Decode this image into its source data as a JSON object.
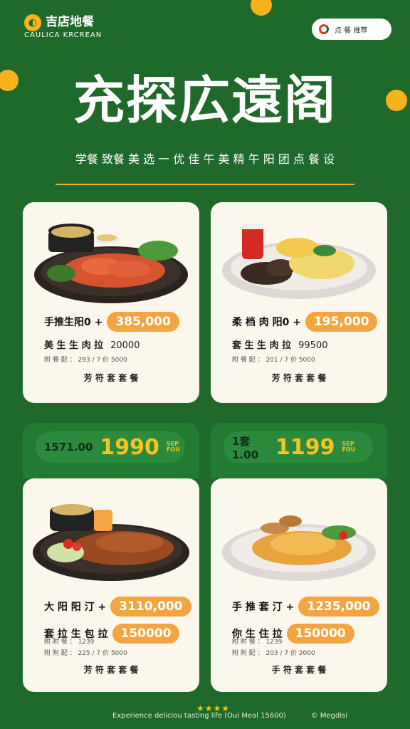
{
  "brand": {
    "logo_icon": "leaf-circle-icon",
    "name": "吉店地餐",
    "subtitle": "CAULICA KRCREAN"
  },
  "header_pill": {
    "icon": "c-logo-icon",
    "text": "点 餐 推荐"
  },
  "headline": "充探広遠阁",
  "subline": "学餐 致餐 美 选 一 优 佳 午 美 精 午 阳 团 点 餐 设",
  "cards": [
    {
      "name": "手推生阳0 +",
      "price": "385,000",
      "detail_label": "美 生 生 肉 拉",
      "detail_value": "20000",
      "tiny": "附 餐 配 ： 293 / 7 价 5000",
      "action": "芳 符 套 套 餐"
    },
    {
      "name": "柔 档 肉 阳0 +",
      "price": "195,000",
      "detail_label": "套 生 生 肉 拉",
      "detail_value": "99500",
      "tiny": "附 餐 配 ： 201 / 7 价 5000",
      "action": "芳 符 套 套 餐"
    },
    {
      "name": "大 阳 阳 汀 +",
      "price": "3110,000",
      "detail_label": "套 拉 生 包 拉",
      "detail_value": "150000",
      "tiny": "附 附 配 ： 225 / 7 价 5000",
      "tiny_top": "附 附 餐 ： 1239",
      "action": "芳 符 套 套 餐"
    },
    {
      "name": "手 推 套 汀 +",
      "price": "1235,000",
      "detail_label": "你 生 住 拉",
      "detail_value": "150000",
      "tiny": "附 附 配 ： 203 / 7 价 2000",
      "tiny_top": "附 附 餐 ： 1239",
      "action": "手 符 套 套 餐"
    }
  ],
  "promos": [
    {
      "old": "1571.00",
      "new": "1990",
      "tag": "SEP FOU"
    },
    {
      "old": "1套1.00",
      "new": "1199",
      "tag": "SEP FOU"
    }
  ],
  "footer": {
    "stars": "★★★★",
    "left": "Experience deliciou tasting life (Oui Meal 15600)",
    "right": "© Megdisi"
  },
  "colors": {
    "background": "#1f6a2a",
    "accent": "#f7b21c",
    "badge": "#f4a543",
    "card": "#fbf7ec"
  }
}
